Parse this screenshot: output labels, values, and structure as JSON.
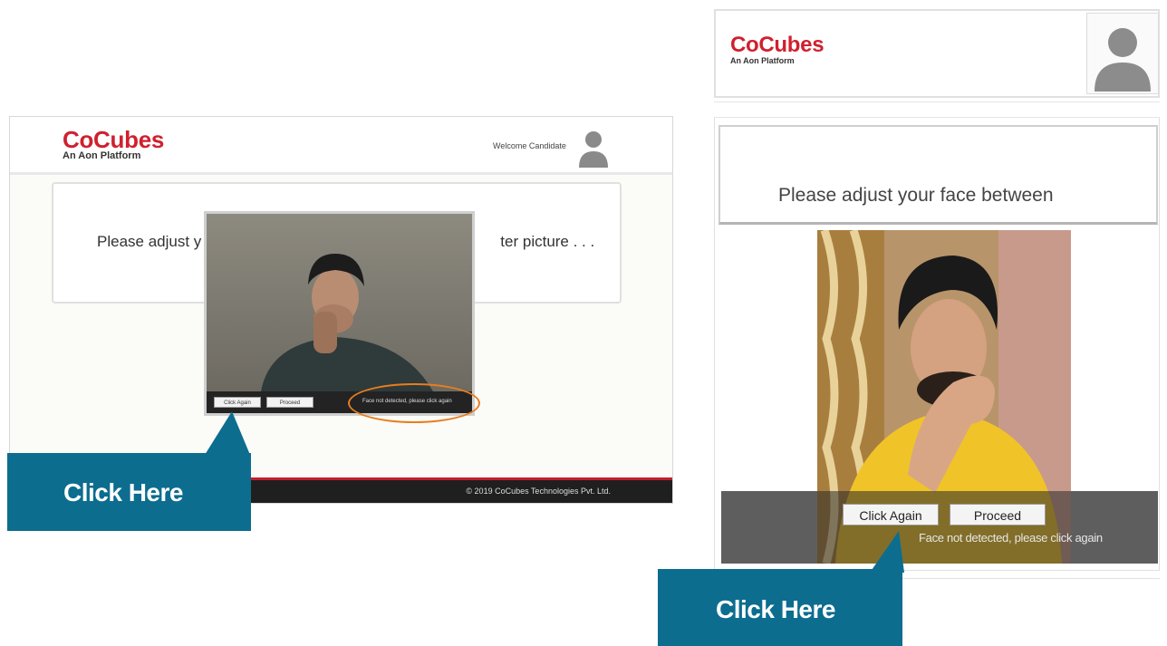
{
  "left": {
    "logo": {
      "name": "CoCubes",
      "tagline": "An Aon Platform"
    },
    "welcome_text": "Welcome Candidate",
    "instruction_start": "Please adjust y",
    "instruction_end": "ter picture . . .",
    "buttons": {
      "click_again": "Click Again",
      "proceed": "Proceed"
    },
    "status_text": "Face not detected, please click again",
    "footer": "© 2019 CoCubes Technologies Pvt. Ltd."
  },
  "right": {
    "logo": {
      "name": "CoCubes",
      "tagline": "An Aon Platform"
    },
    "instruction": "Please adjust your face between",
    "buttons": {
      "click_again": "Click Again",
      "proceed": "Proceed"
    },
    "status_text": "Face not detected, please click again"
  },
  "callouts": {
    "left": "Click Here",
    "right": "Click Here"
  },
  "colors": {
    "brand_red": "#d0202e",
    "callout_blue": "#0c6d8f",
    "highlight_orange": "#e87d1f"
  },
  "icons": [
    "user-avatar-icon",
    "callout-pointer-icon"
  ]
}
